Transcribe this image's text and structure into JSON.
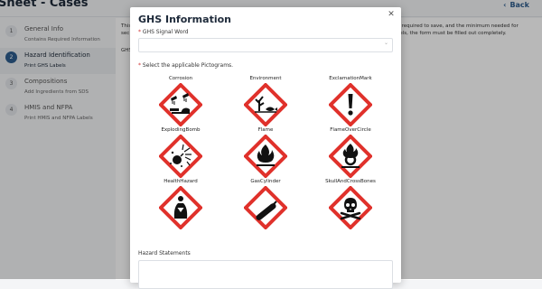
{
  "page": {
    "title": "Sheet - Cases",
    "back_label": "Back",
    "back_icon": "chevron-left-icon"
  },
  "steps": [
    {
      "num": "1",
      "title": "General Info",
      "sub": "Contains Required Information"
    },
    {
      "num": "2",
      "title": "Hazard Identification",
      "sub": "Print GHS Labels"
    },
    {
      "num": "3",
      "title": "Compositions",
      "sub": "Add Ingredients from SDS"
    },
    {
      "num": "4",
      "title": "HMIS and NFPA",
      "sub": "Print HMIS and NFPA Labels"
    }
  ],
  "bg_card": {
    "line1": "This",
    "line2": "sec",
    "right1": "are required to save, and the minimum needed for",
    "right2": "labels, the form must be filled out completely.",
    "ghs": "GHS"
  },
  "modal": {
    "title": "GHS Information",
    "close_icon": "close-icon",
    "required_mark": "*",
    "signal_label": "GHS Signal Word",
    "signal_value": "",
    "pictograms_label": "Select the applicable Pictograms.",
    "pictograms": [
      {
        "name": "Corrosion",
        "icon": "corrosion-icon"
      },
      {
        "name": "Environment",
        "icon": "environment-icon"
      },
      {
        "name": "ExclamationMark",
        "icon": "exclamation-mark-icon"
      },
      {
        "name": "ExplodingBomb",
        "icon": "exploding-bomb-icon"
      },
      {
        "name": "Flame",
        "icon": "flame-icon"
      },
      {
        "name": "FlameOverCircle",
        "icon": "flame-over-circle-icon"
      },
      {
        "name": "HealthHazard",
        "icon": "health-hazard-icon"
      },
      {
        "name": "GasCylinder",
        "icon": "gas-cylinder-icon"
      },
      {
        "name": "SkullAndCrossBones",
        "icon": "skull-and-crossbones-icon"
      }
    ],
    "hazard_statements_label": "Hazard Statements",
    "hazard_statements_value": ""
  },
  "colors": {
    "ghs_red": "#e0312b",
    "primary": "#2e5e8e",
    "required": "#d03030"
  }
}
